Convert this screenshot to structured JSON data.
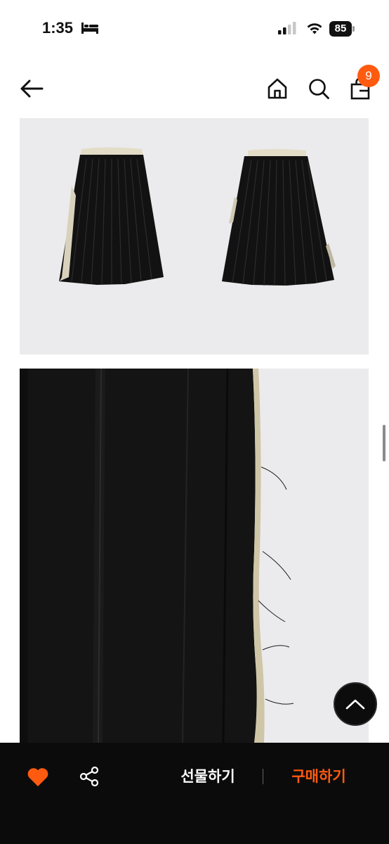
{
  "status_bar": {
    "time": "1:35",
    "battery": "85"
  },
  "nav": {
    "cart_count": "9"
  },
  "actions": {
    "gift_label": "선물하기",
    "buy_label": "구매하기"
  },
  "colors": {
    "accent": "#ff5b10",
    "bottom_bar": "#0b0b0b",
    "image_background": "#ebebed"
  },
  "icons": [
    "bed-icon",
    "signal-icon",
    "wifi-icon",
    "battery-icon",
    "back-arrow-icon",
    "home-icon",
    "search-icon",
    "shopping-bag-icon",
    "chevron-up-icon",
    "heart-icon",
    "share-icon"
  ]
}
